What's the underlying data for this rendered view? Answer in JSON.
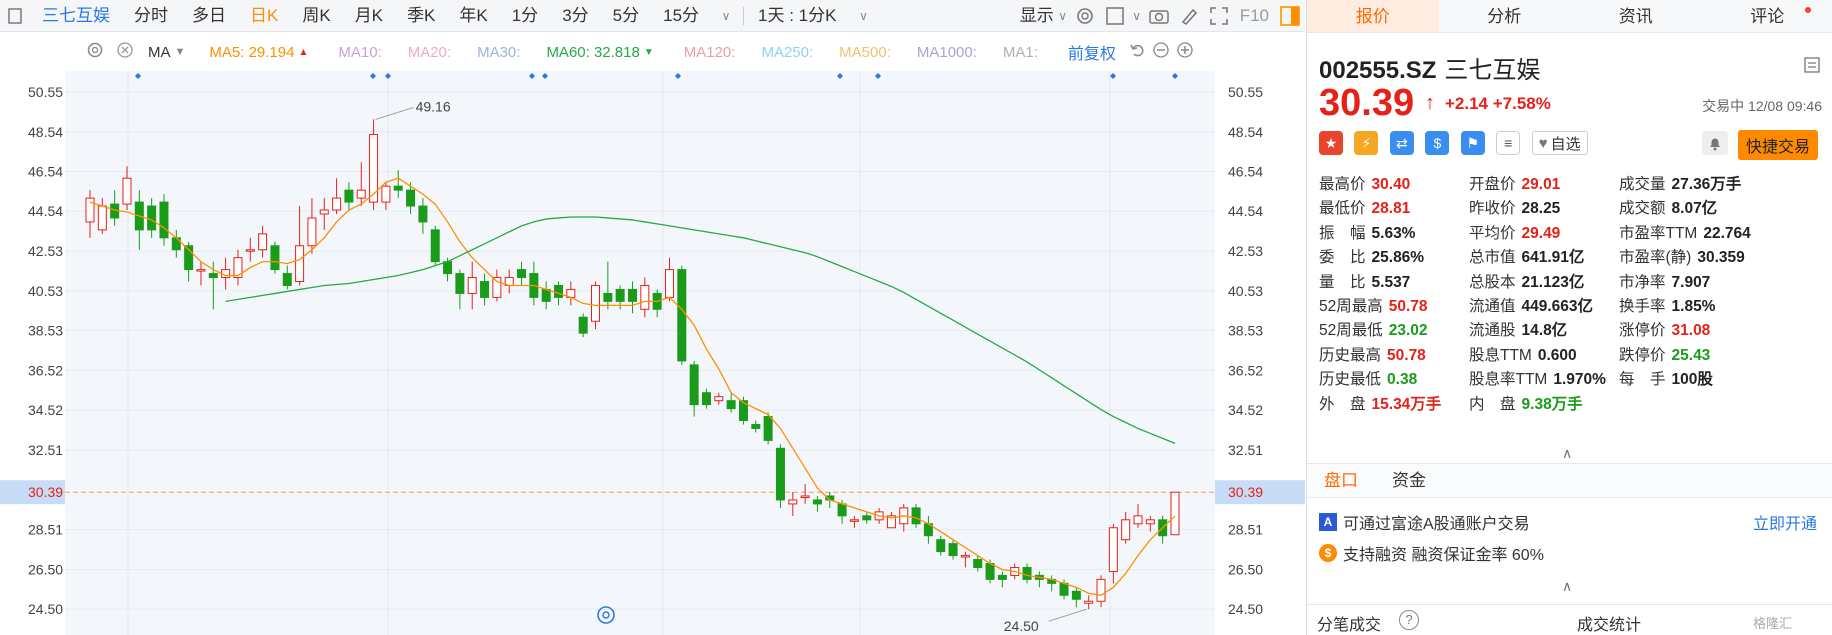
{
  "toolbar": {
    "stock_name": "三七互娱",
    "periods": [
      "分时",
      "多日",
      "日K",
      "周K",
      "月K",
      "季K",
      "年K",
      "1分",
      "3分",
      "5分",
      "15分"
    ],
    "active_period": "日K",
    "multi_period": "1天 : 1分K",
    "display_label": "显示",
    "f10_label": "F10"
  },
  "ma_bar": {
    "ma_label": "MA",
    "ma5_label": "MA5: 29.194",
    "ma10_label": "MA10:",
    "ma20_label": "MA20:",
    "ma30_label": "MA30:",
    "ma60_label": "MA60: 32.818",
    "ma120_label": "MA120:",
    "ma250_label": "MA250:",
    "ma500_label": "MA500:",
    "ma1000_label": "MA1000:",
    "ma1_label": "MA1:",
    "adjust_label": "前复权",
    "colors": {
      "ma5": "#ff8f00",
      "ma10": "#c9a0dc",
      "ma20": "#f4a9c0",
      "ma30": "#9ab5d9",
      "ma60": "#27a844",
      "ma120": "#e8a0a0",
      "ma250": "#8fd3f0",
      "ma500": "#f0c070",
      "ma1000": "#b0a0d8",
      "ma1": "#b0b0b0"
    }
  },
  "chart_data": {
    "type": "candlestick",
    "y_ticks": [
      "50.55",
      "48.54",
      "46.54",
      "44.54",
      "42.53",
      "40.53",
      "38.53",
      "36.52",
      "34.52",
      "32.51",
      "30.39",
      "28.51",
      "26.50",
      "24.50"
    ],
    "ylim": [
      23.2,
      51.6
    ],
    "current_price": 30.39,
    "current_price_label": "30.39",
    "high_label": "49.16",
    "low_label": "24.50",
    "candles": [
      [
        44.0,
        45.2,
        45.6,
        43.2
      ],
      [
        43.6,
        44.8,
        45.2,
        43.4
      ],
      [
        44.9,
        44.2,
        45.6,
        43.8
      ],
      [
        44.9,
        46.2,
        46.8,
        44.6
      ],
      [
        45.0,
        43.6,
        45.6,
        42.6
      ],
      [
        44.8,
        43.6,
        45.2,
        43.2
      ],
      [
        45.0,
        43.2,
        45.4,
        42.8
      ],
      [
        43.2,
        42.6,
        43.6,
        42.2
      ],
      [
        42.8,
        41.6,
        43.0,
        41.0
      ],
      [
        41.6,
        41.6,
        42.0,
        40.8
      ],
      [
        41.4,
        41.2,
        42.0,
        39.6
      ],
      [
        41.2,
        41.6,
        42.2,
        40.6
      ],
      [
        41.2,
        42.2,
        42.6,
        40.8
      ],
      [
        42.6,
        42.6,
        43.2,
        42.0
      ],
      [
        42.6,
        43.4,
        43.8,
        42.2
      ],
      [
        42.8,
        41.6,
        43.0,
        41.4
      ],
      [
        41.4,
        40.8,
        41.8,
        40.6
      ],
      [
        41.0,
        42.8,
        44.8,
        40.8
      ],
      [
        42.8,
        44.2,
        45.2,
        42.4
      ],
      [
        44.4,
        44.6,
        45.2,
        43.6
      ],
      [
        44.6,
        45.2,
        46.2,
        44.4
      ],
      [
        45.6,
        45.0,
        46.0,
        44.6
      ],
      [
        45.2,
        45.6,
        47.0,
        44.8
      ],
      [
        45.0,
        48.4,
        49.16,
        44.6
      ],
      [
        45.0,
        45.8,
        46.0,
        44.6
      ],
      [
        45.8,
        45.6,
        46.6,
        45.2
      ],
      [
        45.6,
        44.8,
        46.0,
        44.4
      ],
      [
        44.8,
        44.0,
        45.2,
        43.4
      ],
      [
        43.6,
        42.0,
        43.8,
        41.8
      ],
      [
        42.0,
        41.4,
        42.2,
        41.0
      ],
      [
        41.4,
        40.4,
        41.6,
        39.6
      ],
      [
        40.4,
        41.2,
        42.0,
        39.6
      ],
      [
        41.0,
        40.2,
        41.4,
        39.8
      ],
      [
        40.2,
        41.2,
        41.6,
        40.0
      ],
      [
        40.8,
        41.2,
        41.6,
        40.4
      ],
      [
        41.6,
        41.2,
        42.0,
        40.8
      ],
      [
        41.4,
        40.2,
        42.0,
        39.8
      ],
      [
        40.6,
        40.0,
        41.0,
        39.6
      ],
      [
        40.8,
        40.2,
        41.0,
        39.8
      ],
      [
        40.2,
        40.6,
        41.0,
        39.8
      ],
      [
        39.2,
        38.4,
        39.4,
        38.2
      ],
      [
        39.0,
        40.8,
        41.0,
        38.6
      ],
      [
        40.4,
        40.0,
        42.0,
        39.6
      ],
      [
        40.6,
        40.0,
        40.8,
        39.6
      ],
      [
        40.6,
        40.0,
        41.0,
        39.4
      ],
      [
        39.6,
        40.8,
        41.2,
        39.2
      ],
      [
        40.4,
        39.6,
        40.6,
        39.2
      ],
      [
        40.2,
        41.6,
        42.2,
        40.0
      ],
      [
        41.6,
        37.0,
        41.8,
        36.8
      ],
      [
        36.8,
        34.8,
        37.0,
        34.2
      ],
      [
        35.4,
        34.8,
        35.6,
        34.6
      ],
      [
        35.0,
        35.2,
        35.4,
        34.8
      ],
      [
        35.0,
        34.6,
        35.4,
        34.4
      ],
      [
        35.0,
        34.0,
        35.2,
        33.8
      ],
      [
        33.8,
        33.6,
        34.0,
        33.4
      ],
      [
        34.2,
        33.0,
        34.4,
        32.8
      ],
      [
        32.6,
        30.0,
        32.8,
        29.6
      ],
      [
        29.8,
        30.0,
        30.4,
        29.2
      ],
      [
        30.2,
        30.2,
        30.8,
        29.8
      ],
      [
        30.0,
        29.8,
        30.2,
        29.4
      ],
      [
        30.2,
        30.0,
        30.4,
        29.6
      ],
      [
        29.8,
        29.2,
        30.0,
        28.8
      ],
      [
        29.0,
        29.0,
        29.2,
        28.6
      ],
      [
        29.2,
        29.0,
        29.4,
        28.8
      ],
      [
        29.0,
        29.4,
        29.6,
        28.8
      ],
      [
        28.6,
        29.2,
        29.4,
        28.6
      ],
      [
        28.8,
        29.6,
        29.8,
        28.4
      ],
      [
        29.6,
        28.8,
        29.8,
        28.6
      ],
      [
        28.8,
        28.2,
        29.2,
        27.8
      ],
      [
        28.0,
        27.4,
        28.2,
        27.2
      ],
      [
        27.8,
        27.2,
        28.0,
        27.0
      ],
      [
        27.2,
        27.2,
        27.4,
        26.6
      ],
      [
        27.0,
        26.6,
        27.2,
        26.4
      ],
      [
        26.8,
        26.0,
        27.0,
        25.8
      ],
      [
        26.2,
        26.0,
        26.4,
        25.6
      ],
      [
        26.2,
        26.6,
        26.8,
        26.0
      ],
      [
        26.6,
        26.0,
        26.8,
        25.8
      ],
      [
        26.2,
        26.0,
        26.4,
        25.6
      ],
      [
        26.0,
        25.8,
        26.2,
        25.4
      ],
      [
        25.8,
        25.2,
        26.0,
        25.0
      ],
      [
        25.4,
        25.0,
        25.6,
        24.6
      ],
      [
        24.8,
        24.9,
        25.2,
        24.5
      ],
      [
        24.9,
        26.0,
        26.2,
        24.6
      ],
      [
        26.4,
        28.6,
        28.8,
        25.8
      ],
      [
        28.0,
        29.0,
        29.4,
        27.8
      ],
      [
        28.8,
        29.2,
        29.8,
        28.6
      ],
      [
        28.8,
        29.0,
        29.2,
        28.4
      ],
      [
        29.0,
        28.2,
        29.2,
        27.8
      ],
      [
        28.25,
        30.39,
        30.4,
        28.81
      ]
    ],
    "ma5": [
      45.0,
      44.8,
      44.6,
      44.5,
      44.3,
      44.1,
      43.7,
      43.2,
      42.6,
      42.0,
      41.6,
      41.3,
      41.3,
      41.7,
      42.0,
      42.0,
      41.9,
      42.1,
      42.6,
      43.2,
      44.0,
      44.6,
      44.9,
      45.4,
      46.0,
      46.2,
      45.8,
      45.4,
      44.9,
      44.0,
      43.0,
      42.2,
      41.6,
      41.0,
      40.8,
      40.8,
      40.8,
      40.6,
      40.4,
      40.2,
      39.9,
      39.8,
      39.8,
      39.8,
      39.8,
      40.0,
      40.0,
      40.2,
      39.6,
      38.8,
      37.6,
      36.6,
      35.4,
      34.9,
      34.6,
      34.3,
      33.6,
      32.6,
      31.6,
      30.6,
      30.0,
      29.8,
      29.6,
      29.4,
      29.2,
      29.1,
      29.2,
      29.1,
      28.8,
      28.4,
      28.0,
      27.6,
      27.2,
      26.8,
      26.5,
      26.4,
      26.2,
      26.1,
      26.0,
      25.8,
      25.6,
      25.3,
      25.2,
      25.6,
      26.3,
      27.2,
      28.0,
      28.6,
      29.19
    ],
    "ma60": [
      40.0,
      40.1,
      40.2,
      40.3,
      40.4,
      40.5,
      40.6,
      40.7,
      40.8,
      40.85,
      40.9,
      41.0,
      41.1,
      41.2,
      41.3,
      41.45,
      41.6,
      41.8,
      42.0,
      42.3,
      42.6,
      42.9,
      43.2,
      43.5,
      43.8,
      44.0,
      44.15,
      44.2,
      44.25,
      44.25,
      44.25,
      44.2,
      44.15,
      44.1,
      44.0,
      43.9,
      43.8,
      43.7,
      43.6,
      43.5,
      43.4,
      43.3,
      43.2,
      43.05,
      42.9,
      42.75,
      42.6,
      42.45,
      42.25,
      42.0,
      41.75,
      41.5,
      41.25,
      41.0,
      40.75,
      40.45,
      40.1,
      39.75,
      39.4,
      39.05,
      38.7,
      38.35,
      38.0,
      37.65,
      37.3,
      36.95,
      36.55,
      36.15,
      35.75,
      35.35,
      34.95,
      34.55,
      34.2,
      33.9,
      33.6,
      33.35,
      33.1,
      32.85
    ],
    "up_color": "#e62117",
    "down_color": "#1a9b1a"
  },
  "quote": {
    "code": "002555.SZ",
    "name": "三七互娱",
    "price": "30.39",
    "change": "+2.14 +7.58%",
    "status": "交易中 12/08 09:46",
    "watch_label": "自选",
    "fast_trade_label": "快捷交易"
  },
  "stats": [
    [
      {
        "l": "最高价",
        "v": "30.40",
        "c": "red"
      },
      {
        "l": "开盘价",
        "v": "29.01",
        "c": "red"
      },
      {
        "l": "成交量",
        "v": "27.36万手",
        "c": "dark"
      }
    ],
    [
      {
        "l": "最低价",
        "v": "28.81",
        "c": "red"
      },
      {
        "l": "昨收价",
        "v": "28.25",
        "c": "dark"
      },
      {
        "l": "成交额",
        "v": "8.07亿",
        "c": "dark"
      }
    ],
    [
      {
        "l": "振　幅",
        "v": "5.63%",
        "c": "dark"
      },
      {
        "l": "平均价",
        "v": "29.49",
        "c": "red"
      },
      {
        "l": "市盈率TTM",
        "v": "22.764",
        "c": "dark"
      }
    ],
    [
      {
        "l": "委　比",
        "v": "25.86%",
        "c": "dark"
      },
      {
        "l": "总市值",
        "v": "641.91亿",
        "c": "dark"
      },
      {
        "l": "市盈率(静)",
        "v": "30.359",
        "c": "dark"
      }
    ],
    [
      {
        "l": "量　比",
        "v": "5.537",
        "c": "dark"
      },
      {
        "l": "总股本",
        "v": "21.123亿",
        "c": "dark"
      },
      {
        "l": "市净率",
        "v": "7.907",
        "c": "dark"
      }
    ],
    [
      {
        "l": "52周最高",
        "v": "50.78",
        "c": "red"
      },
      {
        "l": "流通值",
        "v": "449.663亿",
        "c": "dark"
      },
      {
        "l": "换手率",
        "v": "1.85%",
        "c": "dark"
      }
    ],
    [
      {
        "l": "52周最低",
        "v": "23.02",
        "c": "green"
      },
      {
        "l": "流通股",
        "v": "14.8亿",
        "c": "dark"
      },
      {
        "l": "涨停价",
        "v": "31.08",
        "c": "red"
      }
    ],
    [
      {
        "l": "历史最高",
        "v": "50.78",
        "c": "red"
      },
      {
        "l": "股息TTM",
        "v": "0.600",
        "c": "dark"
      },
      {
        "l": "跌停价",
        "v": "25.43",
        "c": "green"
      }
    ],
    [
      {
        "l": "历史最低",
        "v": "0.38",
        "c": "green"
      },
      {
        "l": "股息率TTM",
        "v": "1.970%",
        "c": "dark"
      },
      {
        "l": "每　手",
        "v": "100股",
        "c": "dark"
      }
    ],
    [
      {
        "l": "外　盘",
        "v": "15.34万手",
        "c": "red"
      },
      {
        "l": "内　盘",
        "v": "9.38万手",
        "c": "green"
      }
    ]
  ],
  "right_tabs": [
    "报价",
    "分析",
    "资讯",
    "评论"
  ],
  "panel_tabs": [
    "盘口",
    "资金"
  ],
  "info": {
    "a_share_text": "可通过富途A股通账户交易",
    "open_now": "立即开通",
    "margin_text": "支持融资  融资保证金率 60%"
  },
  "bottom": {
    "tick_label": "分笔成交",
    "stats_label": "成交统计",
    "watermark": "格隆汇"
  }
}
